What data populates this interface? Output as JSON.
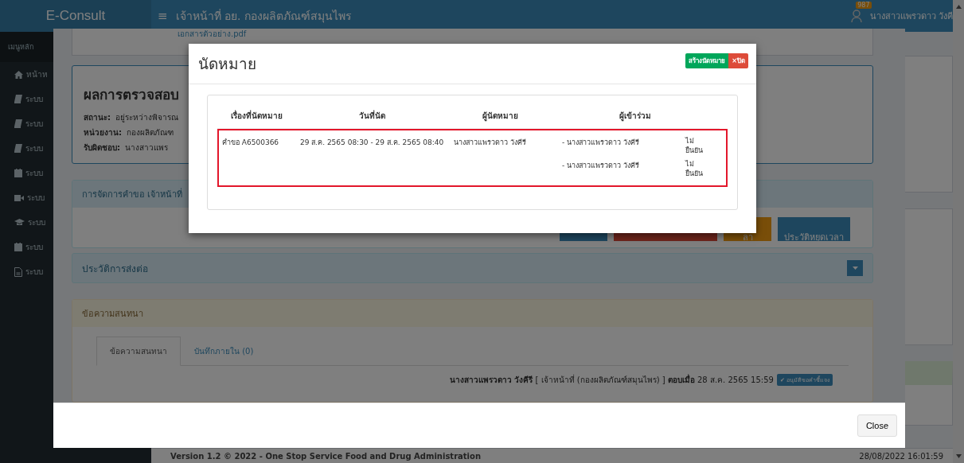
{
  "header": {
    "brand": "E-Consult",
    "menu_glyph": "≡",
    "title": "เจ้าหน้าที่ อย. กองผลิตภัณฑ์สมุนไพร",
    "badge": "987",
    "user": "นางสาวแพรวดาว วังคี"
  },
  "sidebar": {
    "heading": "เมนูหลัก",
    "items": [
      {
        "kind": "home",
        "label": "หน้าห"
      },
      {
        "kind": "book",
        "label": "ระบบ"
      },
      {
        "kind": "book",
        "label": "ระบบ"
      },
      {
        "kind": "book",
        "label": "ระบบ"
      },
      {
        "kind": "calendar",
        "label": "ระบบ"
      },
      {
        "kind": "video",
        "label": "ระบบ"
      },
      {
        "kind": "cap",
        "label": "ระบบ"
      },
      {
        "kind": "calendar",
        "label": "ระบบ"
      },
      {
        "kind": "file",
        "label": "ระบบ"
      }
    ]
  },
  "detail_modal": {
    "attachment": "เอกสารตัวอย่าง.pdf",
    "result": {
      "title": "ผลการตรวจสอบ",
      "fields": [
        {
          "label": "สถานะ:",
          "value": "อยู่ระหว่างพิจารณ"
        },
        {
          "label": "หน่วยงาน:",
          "value": "กองผลิตภัณฑ"
        },
        {
          "label": "รับผิดชอบ:",
          "value": "นางสาวแพร"
        }
      ]
    },
    "manage_panel": {
      "title": "การจัดการคำขอ เจ้าหน้าที่",
      "buttons": [
        {
          "kind": "primary"
        },
        {
          "kind": "danger"
        },
        {
          "kind": "warning",
          "label": "ลา"
        },
        {
          "kind": "primary",
          "label": "ประวัติหยุดเวลา"
        }
      ]
    },
    "history_panel": {
      "title": "ประวัติการส่งต่อ"
    },
    "chat_panel": {
      "title": "ข้อความสนทนา",
      "tabs": [
        {
          "label": "ข้อความสนทนา",
          "selected": true
        },
        {
          "label": "บันทึกภายใน (0)",
          "selected": false
        }
      ],
      "message": {
        "meta": "**นางสาวแพรวดาว วังคีรี** [ เจ้าหน้าที่ (กองผลิตภัณฑ์สมุนไพร) ] **ตอบเมื่อ** 28 ส.ค. 2565 15:59",
        "badge": "✔ อนุมัติขอคำชี้แจง"
      }
    },
    "close_button": "Close"
  },
  "appointment_modal": {
    "title": "นัดหมาย",
    "create_button": "สร้างนัดหมาย",
    "close_button": "×ปิด",
    "columns": [
      "เรื่องที่นัดหมาย",
      "วันที่นัด",
      "ผู้นัดหมาย",
      "ผู้เข้าร่วม"
    ],
    "rows": [
      {
        "subject": "คำขอ A6500366",
        "date": "29 ส.ค. 2565 08:30 - 29 ส.ค. 2565 08:40",
        "organizer": "นางสาวแพรวดาว วังคีรี",
        "highlighted": true,
        "attendees": [
          {
            "name": "- นางสาวแพรวดาว วังคีรี",
            "status": "ไม่ยืนยัน"
          },
          {
            "name": "- นางสาวแพรวดาว วังคีรี",
            "status": "ไม่ยืนยัน"
          }
        ]
      }
    ]
  },
  "footer": {
    "version": "Version 1.2 © 2022 - One Stop Service Food and Drug Administration",
    "timestamp": "28/08/2022 16:01:59"
  }
}
